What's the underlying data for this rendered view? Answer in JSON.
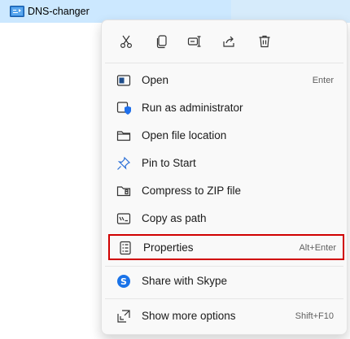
{
  "file": {
    "name": "DNS-changer"
  },
  "colors": {
    "selection": "#cce8ff",
    "highlight_border": "#d00000",
    "menu_bg": "#f9f9f9",
    "skype": "#1a73e8"
  },
  "toolbar": {
    "items": [
      {
        "name": "cut-icon"
      },
      {
        "name": "copy-icon"
      },
      {
        "name": "rename-icon"
      },
      {
        "name": "share-icon"
      },
      {
        "name": "delete-icon"
      }
    ]
  },
  "menu": {
    "items": [
      {
        "label": "Open",
        "shortcut": "Enter",
        "icon": "open-icon"
      },
      {
        "label": "Run as administrator",
        "shortcut": "",
        "icon": "admin-shield-icon"
      },
      {
        "label": "Open file location",
        "shortcut": "",
        "icon": "folder-icon"
      },
      {
        "label": "Pin to Start",
        "shortcut": "",
        "icon": "pin-icon"
      },
      {
        "label": "Compress to ZIP file",
        "shortcut": "",
        "icon": "zip-icon"
      },
      {
        "label": "Copy as path",
        "shortcut": "",
        "icon": "copy-path-icon"
      },
      {
        "label": "Properties",
        "shortcut": "Alt+Enter",
        "icon": "properties-icon",
        "highlighted": true
      },
      {
        "label": "Share with Skype",
        "shortcut": "",
        "icon": "skype-icon"
      },
      {
        "label": "Show more options",
        "shortcut": "Shift+F10",
        "icon": "more-options-icon"
      }
    ]
  }
}
